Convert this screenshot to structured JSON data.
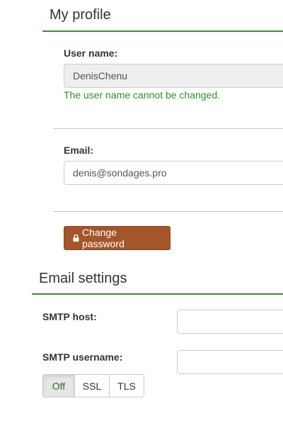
{
  "profile": {
    "title": "My profile",
    "username_label": "User name:",
    "username_value": "DenisChenu",
    "username_help": "The user name cannot be changed.",
    "email_label": "Email:",
    "email_value": "denis@sondages.pro",
    "change_password_label": "Change password"
  },
  "email_settings": {
    "title": "Email settings",
    "smtp_host_label": "SMTP host:",
    "smtp_host_value": "",
    "smtp_username_label": "SMTP username:",
    "smtp_username_value": "",
    "ssl_options": [
      "Off",
      "SSL",
      "TLS"
    ],
    "ssl_selected": "Off"
  },
  "colors": {
    "accent_green": "#3d8b3d",
    "help_text": "#2f8f2f",
    "button_brown": "#a5552a"
  }
}
